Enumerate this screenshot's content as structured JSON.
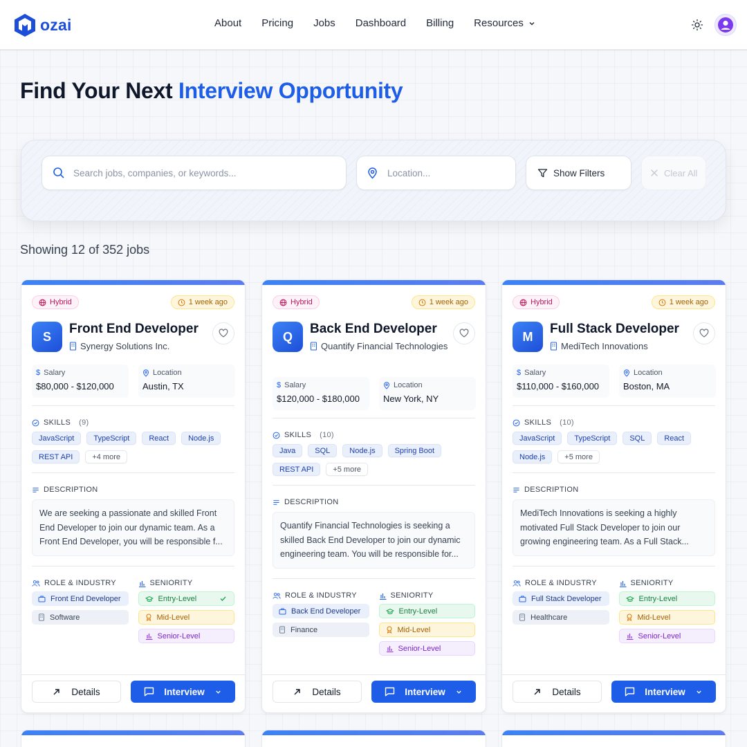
{
  "brand": {
    "name": "ozai"
  },
  "nav": {
    "links": [
      "About",
      "Pricing",
      "Jobs",
      "Dashboard",
      "Billing",
      "Resources"
    ]
  },
  "hero": {
    "title_plain": "Find Your Next ",
    "title_accent": "Interview Opportunity"
  },
  "search": {
    "keyword_placeholder": "Search jobs, companies, or keywords...",
    "location_placeholder": "Location...",
    "filters_label": "Show Filters",
    "clear_label": "Clear All"
  },
  "results": {
    "summary": "Showing 12 of 352 jobs"
  },
  "labels": {
    "salary": "Salary",
    "location": "Location",
    "skills": "SKILLS",
    "description": "DESCRIPTION",
    "role_industry": "ROLE & INDUSTRY",
    "seniority": "SENIORITY",
    "details": "Details",
    "interview": "Interview"
  },
  "colors": {
    "accent": "#1d5de8",
    "hybrid": "#be185d",
    "time": "#a16207"
  },
  "jobs": [
    {
      "work_mode": "Hybrid",
      "posted": "1 week ago",
      "initial": "S",
      "title": "Front End Developer",
      "company": "Synergy Solutions Inc.",
      "salary": "$80,000 - $120,000",
      "location": "Austin, TX",
      "skills_count": "(9)",
      "skills": [
        "JavaScript",
        "TypeScript",
        "React",
        "Node.js",
        "REST API"
      ],
      "skills_more": "+4 more",
      "description": "We are seeking a passionate and skilled Front End Developer to join our dynamic team. As a Front End Developer, you will be responsible f...",
      "role": "Front End Developer",
      "industry": "Software",
      "seniority": [
        "Entry-Level",
        "Mid-Level",
        "Senior-Level"
      ],
      "selected_seniority": "Entry-Level"
    },
    {
      "work_mode": "Hybrid",
      "posted": "1 week ago",
      "initial": "Q",
      "title": "Back End Developer",
      "company": "Quantify Financial Technologies",
      "salary": "$120,000 - $180,000",
      "location": "New York, NY",
      "skills_count": "(10)",
      "skills": [
        "Java",
        "SQL",
        "Node.js",
        "Spring Boot",
        "REST API"
      ],
      "skills_more": "+5 more",
      "description": "Quantify Financial Technologies is seeking a skilled Back End Developer to join our dynamic engineering team. You will be responsible for...",
      "role": "Back End Developer",
      "industry": "Finance",
      "seniority": [
        "Entry-Level",
        "Mid-Level",
        "Senior-Level"
      ]
    },
    {
      "work_mode": "Hybrid",
      "posted": "1 week ago",
      "initial": "M",
      "title": "Full Stack Developer",
      "company": "MediTech Innovations",
      "salary": "$110,000 - $160,000",
      "location": "Boston, MA",
      "skills_count": "(10)",
      "skills": [
        "JavaScript",
        "TypeScript",
        "SQL",
        "React",
        "Node.js"
      ],
      "skills_more": "+5 more",
      "description": "MediTech Innovations is seeking a highly motivated Full Stack Developer to join our growing engineering team. As a Full Stack...",
      "role": "Full Stack Developer",
      "industry": "Healthcare",
      "seniority": [
        "Entry-Level",
        "Mid-Level",
        "Senior-Level"
      ]
    }
  ]
}
